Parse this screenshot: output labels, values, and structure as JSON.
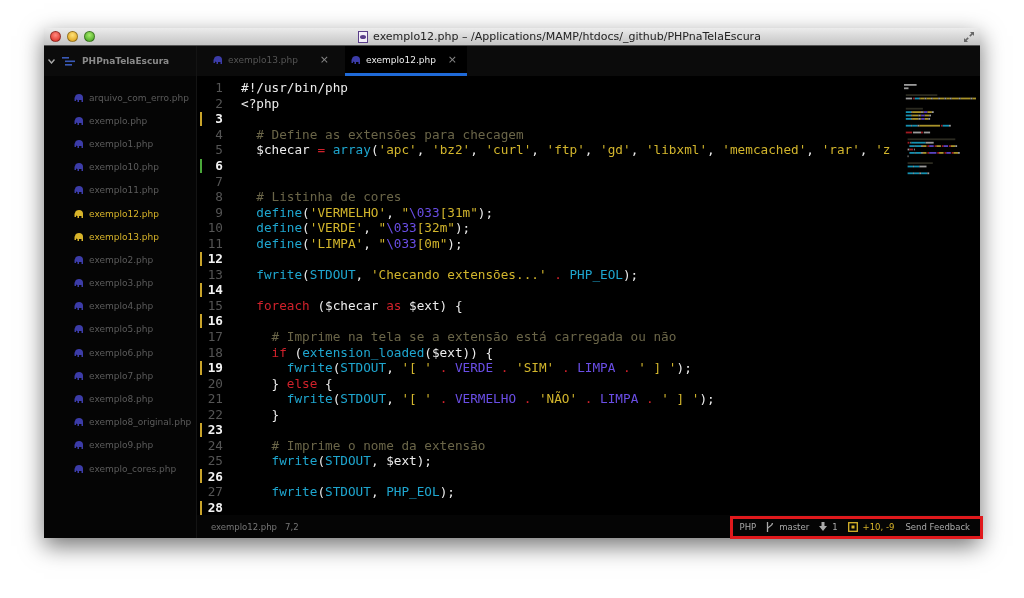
{
  "window": {
    "title": "exemplo12.php – /Applications/MAMP/htdocs/_github/PHPnaTelaEscura"
  },
  "sidebar": {
    "project": "PHPnaTelaEscura",
    "expanded": true,
    "items": [
      {
        "label": "arquivo_com_erro.php",
        "open": false
      },
      {
        "label": "exemplo.php",
        "open": false
      },
      {
        "label": "exemplo1.php",
        "open": false
      },
      {
        "label": "exemplo10.php",
        "open": false
      },
      {
        "label": "exemplo11.php",
        "open": false
      },
      {
        "label": "exemplo12.php",
        "open": true
      },
      {
        "label": "exemplo13.php",
        "open": true
      },
      {
        "label": "exemplo2.php",
        "open": false
      },
      {
        "label": "exemplo3.php",
        "open": false
      },
      {
        "label": "exemplo4.php",
        "open": false
      },
      {
        "label": "exemplo5.php",
        "open": false
      },
      {
        "label": "exemplo6.php",
        "open": false
      },
      {
        "label": "exemplo7.php",
        "open": false
      },
      {
        "label": "exemplo8.php",
        "open": false
      },
      {
        "label": "exemplo8_original.php",
        "open": false
      },
      {
        "label": "exemplo9.php",
        "open": false
      },
      {
        "label": "exemplo_cores.php",
        "open": false
      }
    ]
  },
  "tabs": [
    {
      "label": "exemplo13.php",
      "close": "×",
      "selected": false
    },
    {
      "label": "exemplo12.php",
      "close": "×",
      "selected": true
    }
  ],
  "editor": {
    "lines": [
      {
        "number": "1",
        "modified": false,
        "added": false,
        "segments": [
          {
            "kind": "plain",
            "text": "#!/usr/bin/php"
          }
        ]
      },
      {
        "number": "2",
        "modified": false,
        "added": false,
        "segments": [
          {
            "kind": "plain",
            "text": "<?php"
          }
        ]
      },
      {
        "number": "3",
        "modified": true,
        "added": false
      },
      {
        "number": "4",
        "modified": false,
        "added": false,
        "segments": [
          {
            "kind": "comment",
            "text": "  # Define as extensões para checagem"
          }
        ]
      },
      {
        "number": "5",
        "modified": false,
        "added": false,
        "segments": [
          {
            "kind": "plain",
            "text": "  $checar"
          },
          {
            "kind": "keyword",
            "text": " = "
          },
          {
            "kind": "function",
            "text": "array"
          },
          {
            "kind": "plain",
            "text": "("
          },
          {
            "kind": "string",
            "text": "'apc'"
          },
          {
            "kind": "plain",
            "text": ", "
          },
          {
            "kind": "string",
            "text": "'bz2'"
          },
          {
            "kind": "plain",
            "text": ", "
          },
          {
            "kind": "string",
            "text": "'curl'"
          },
          {
            "kind": "plain",
            "text": ", "
          },
          {
            "kind": "string",
            "text": "'ftp'"
          },
          {
            "kind": "plain",
            "text": ", "
          },
          {
            "kind": "string",
            "text": "'gd'"
          },
          {
            "kind": "plain",
            "text": ", "
          },
          {
            "kind": "string",
            "text": "'libxml'"
          },
          {
            "kind": "plain",
            "text": ", "
          },
          {
            "kind": "string",
            "text": "'memcached'"
          },
          {
            "kind": "plain",
            "text": ", "
          },
          {
            "kind": "string",
            "text": "'rar'"
          },
          {
            "kind": "plain",
            "text": ", "
          },
          {
            "kind": "string",
            "text": "'z"
          }
        ]
      },
      {
        "number": "6",
        "modified": false,
        "added": true
      },
      {
        "number": "7",
        "modified": false,
        "added": false
      },
      {
        "number": "8",
        "modified": false,
        "added": false,
        "segments": [
          {
            "kind": "comment",
            "text": "  # Listinha de cores"
          }
        ]
      },
      {
        "number": "9",
        "modified": false,
        "added": false,
        "segments": [
          {
            "kind": "function",
            "text": "  define"
          },
          {
            "kind": "plain",
            "text": "("
          },
          {
            "kind": "string",
            "text": "'VERMELHO'"
          },
          {
            "kind": "plain",
            "text": ", "
          },
          {
            "kind": "string",
            "text": "\""
          },
          {
            "kind": "constant",
            "text": "\\033"
          },
          {
            "kind": "string",
            "text": "[31m\""
          },
          {
            "kind": "plain",
            "text": ");"
          }
        ]
      },
      {
        "number": "10",
        "modified": false,
        "added": false,
        "segments": [
          {
            "kind": "function",
            "text": "  define"
          },
          {
            "kind": "plain",
            "text": "("
          },
          {
            "kind": "string",
            "text": "'VERDE'"
          },
          {
            "kind": "plain",
            "text": ", "
          },
          {
            "kind": "string",
            "text": "\""
          },
          {
            "kind": "constant",
            "text": "\\033"
          },
          {
            "kind": "string",
            "text": "[32m\""
          },
          {
            "kind": "plain",
            "text": ");"
          }
        ]
      },
      {
        "number": "11",
        "modified": false,
        "added": false,
        "segments": [
          {
            "kind": "function",
            "text": "  define"
          },
          {
            "kind": "plain",
            "text": "("
          },
          {
            "kind": "string",
            "text": "'LIMPA'"
          },
          {
            "kind": "plain",
            "text": ", "
          },
          {
            "kind": "string",
            "text": "\""
          },
          {
            "kind": "constant",
            "text": "\\033"
          },
          {
            "kind": "string",
            "text": "[0m\""
          },
          {
            "kind": "plain",
            "text": ");"
          }
        ]
      },
      {
        "number": "12",
        "modified": true,
        "added": false
      },
      {
        "number": "13",
        "modified": false,
        "added": false,
        "segments": [
          {
            "kind": "function",
            "text": "  fwrite"
          },
          {
            "kind": "plain",
            "text": "("
          },
          {
            "kind": "function",
            "text": "STDOUT"
          },
          {
            "kind": "plain",
            "text": ", "
          },
          {
            "kind": "string",
            "text": "'Checando extensões...'"
          },
          {
            "kind": "keyword",
            "text": " . "
          },
          {
            "kind": "function",
            "text": "PHP_EOL"
          },
          {
            "kind": "plain",
            "text": ");"
          }
        ]
      },
      {
        "number": "14",
        "modified": true,
        "added": false
      },
      {
        "number": "15",
        "modified": false,
        "added": false,
        "segments": [
          {
            "kind": "keyword",
            "text": "  foreach"
          },
          {
            "kind": "plain",
            "text": " ($checar "
          },
          {
            "kind": "keyword",
            "text": "as"
          },
          {
            "kind": "plain",
            "text": " $ext) {"
          }
        ]
      },
      {
        "number": "16",
        "modified": true,
        "added": false
      },
      {
        "number": "17",
        "modified": false,
        "added": false,
        "segments": [
          {
            "kind": "comment",
            "text": "    # Imprime na tela se a extensão está carregada ou não"
          }
        ]
      },
      {
        "number": "18",
        "modified": false,
        "added": false,
        "segments": [
          {
            "kind": "keyword",
            "text": "    if"
          },
          {
            "kind": "plain",
            "text": " ("
          },
          {
            "kind": "function",
            "text": "extension_loaded"
          },
          {
            "kind": "plain",
            "text": "($ext)) {"
          }
        ]
      },
      {
        "number": "19",
        "modified": true,
        "added": false,
        "segments": [
          {
            "kind": "function",
            "text": "      fwrite"
          },
          {
            "kind": "plain",
            "text": "("
          },
          {
            "kind": "function",
            "text": "STDOUT"
          },
          {
            "kind": "plain",
            "text": ", "
          },
          {
            "kind": "string",
            "text": "'[ '"
          },
          {
            "kind": "keyword",
            "text": " . "
          },
          {
            "kind": "constant",
            "text": "VERDE"
          },
          {
            "kind": "keyword",
            "text": " . "
          },
          {
            "kind": "string",
            "text": "'SIM'"
          },
          {
            "kind": "keyword",
            "text": " . "
          },
          {
            "kind": "constant",
            "text": "LIMPA"
          },
          {
            "kind": "keyword",
            "text": " . "
          },
          {
            "kind": "string",
            "text": "' ] '"
          },
          {
            "kind": "plain",
            "text": ");"
          }
        ]
      },
      {
        "number": "20",
        "modified": false,
        "added": false,
        "segments": [
          {
            "kind": "plain",
            "text": "    } "
          },
          {
            "kind": "keyword",
            "text": "else"
          },
          {
            "kind": "plain",
            "text": " {"
          }
        ]
      },
      {
        "number": "21",
        "modified": false,
        "added": false,
        "segments": [
          {
            "kind": "function",
            "text": "      fwrite"
          },
          {
            "kind": "plain",
            "text": "("
          },
          {
            "kind": "function",
            "text": "STDOUT"
          },
          {
            "kind": "plain",
            "text": ", "
          },
          {
            "kind": "string",
            "text": "'[ '"
          },
          {
            "kind": "keyword",
            "text": " . "
          },
          {
            "kind": "constant",
            "text": "VERMELHO"
          },
          {
            "kind": "keyword",
            "text": " . "
          },
          {
            "kind": "string",
            "text": "'NÃO'"
          },
          {
            "kind": "keyword",
            "text": " . "
          },
          {
            "kind": "constant",
            "text": "LIMPA"
          },
          {
            "kind": "keyword",
            "text": " . "
          },
          {
            "kind": "string",
            "text": "' ] '"
          },
          {
            "kind": "plain",
            "text": ");"
          }
        ]
      },
      {
        "number": "22",
        "modified": false,
        "added": false,
        "segments": [
          {
            "kind": "plain",
            "text": "    }"
          }
        ]
      },
      {
        "number": "23",
        "modified": true,
        "added": false
      },
      {
        "number": "24",
        "modified": false,
        "added": false,
        "segments": [
          {
            "kind": "comment",
            "text": "    # Imprime o nome da extensão"
          }
        ]
      },
      {
        "number": "25",
        "modified": false,
        "added": false,
        "segments": [
          {
            "kind": "function",
            "text": "    fwrite"
          },
          {
            "kind": "plain",
            "text": "("
          },
          {
            "kind": "function",
            "text": "STDOUT"
          },
          {
            "kind": "plain",
            "text": ", $ext);"
          }
        ]
      },
      {
        "number": "26",
        "modified": true,
        "added": false
      },
      {
        "number": "27",
        "modified": false,
        "added": false,
        "segments": [
          {
            "kind": "function",
            "text": "    fwrite"
          },
          {
            "kind": "plain",
            "text": "("
          },
          {
            "kind": "function",
            "text": "STDOUT"
          },
          {
            "kind": "plain",
            "text": ", "
          },
          {
            "kind": "function",
            "text": "PHP_EOL"
          },
          {
            "kind": "plain",
            "text": ");"
          }
        ]
      },
      {
        "number": "28",
        "modified": true,
        "added": false
      }
    ]
  },
  "status_bar": {
    "file": "exemplo12.php",
    "cursor": "7,2",
    "grammar": "PHP",
    "branch": "master",
    "behind": "1",
    "diff": "+10, -9",
    "feedback": "Send Feedback",
    "highlighted": true
  }
}
